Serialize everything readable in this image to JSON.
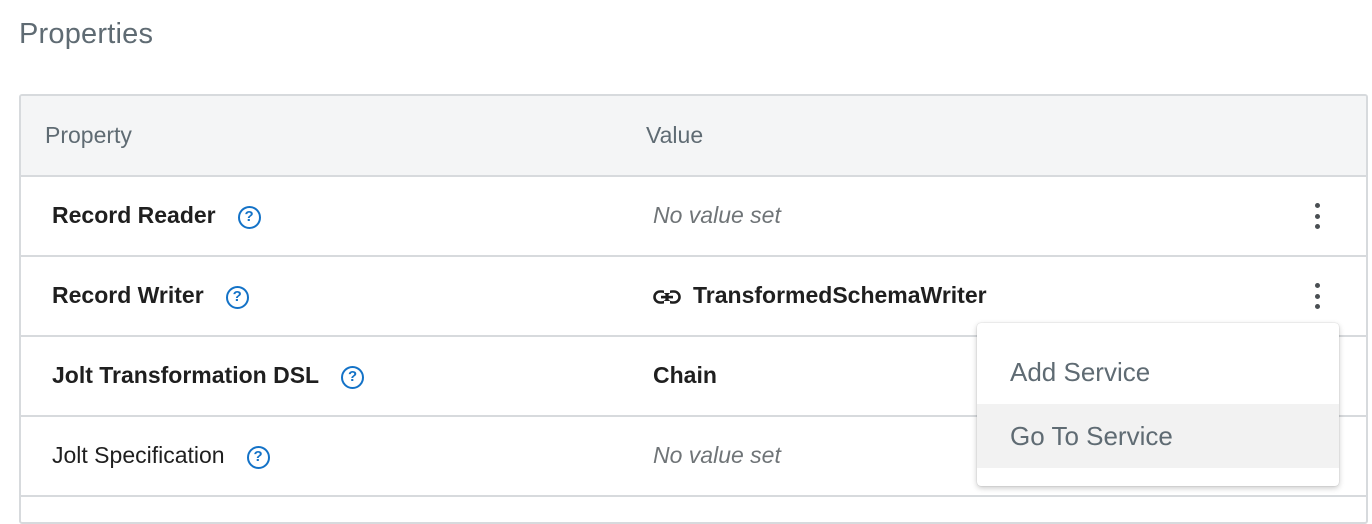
{
  "section": {
    "title": "Properties"
  },
  "table": {
    "headers": {
      "property": "Property",
      "value": "Value"
    },
    "rows": [
      {
        "name": "Record Reader",
        "bold": true,
        "value": "No value set",
        "value_state": "empty",
        "linked": false
      },
      {
        "name": "Record Writer",
        "bold": true,
        "value": "TransformedSchemaWriter",
        "value_state": "set",
        "linked": true
      },
      {
        "name": "Jolt Transformation DSL",
        "bold": true,
        "value": "Chain",
        "value_state": "set",
        "linked": false
      },
      {
        "name": "Jolt Specification",
        "bold": false,
        "value": "No value set",
        "value_state": "empty",
        "linked": false
      }
    ]
  },
  "context_menu": {
    "items": [
      {
        "label": "Add Service",
        "highlighted": false
      },
      {
        "label": "Go To Service",
        "highlighted": true
      }
    ]
  },
  "icons": {
    "help": "help-circle-icon",
    "link": "link-icon",
    "more": "kebab-menu-icon"
  },
  "colors": {
    "accent": "#1372c7",
    "border": "#d7dadd",
    "header_bg": "#f4f5f6",
    "menu_highlight": "#f2f2f2"
  }
}
